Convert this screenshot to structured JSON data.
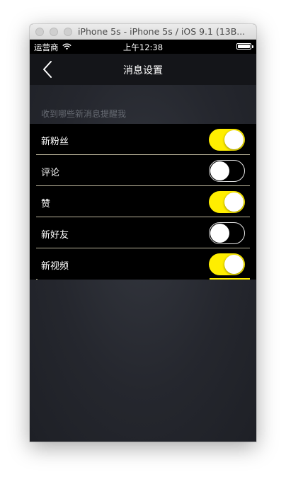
{
  "window": {
    "title": "iPhone 5s - iPhone 5s / iOS 9.1 (13B..."
  },
  "statusbar": {
    "carrier": "运营商",
    "time": "上午12:38",
    "icons": [
      "wifi-icon",
      "battery-icon"
    ]
  },
  "navbar": {
    "back_icon": "chevron-left-icon",
    "title": "消息设置"
  },
  "settings": {
    "section_header": "收到哪些新消息提醒我",
    "items": [
      {
        "label": "新粉丝",
        "enabled": true
      },
      {
        "label": "评论",
        "enabled": false
      },
      {
        "label": "赞",
        "enabled": true
      },
      {
        "label": "新好友",
        "enabled": false
      },
      {
        "label": "新视频",
        "enabled": true
      }
    ]
  },
  "colors": {
    "toggle_on": "#ffee00",
    "toggle_off_border": "#e6e6e6",
    "nav_background": "#141519",
    "list_background": "#000000",
    "section_header_text": "#666a72"
  }
}
